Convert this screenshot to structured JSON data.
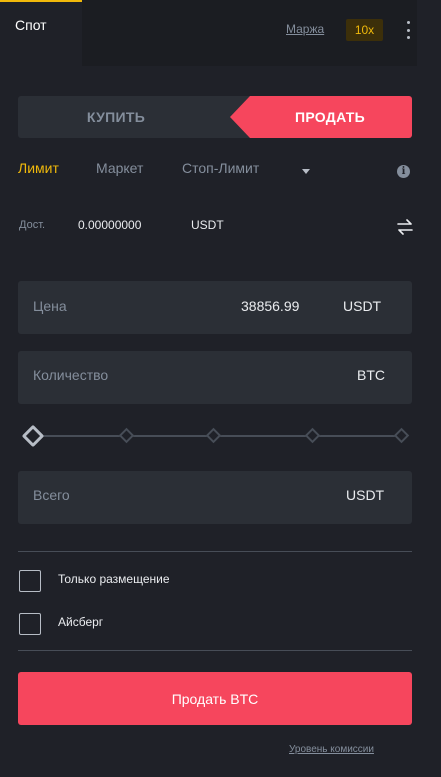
{
  "header": {
    "title": "Спот",
    "margin_label": "Маржа",
    "leverage": "10x",
    "more_icon": "kebab-menu-icon"
  },
  "side": {
    "buy_label": "КУПИТЬ",
    "sell_label": "ПРОДАТЬ",
    "active": "sell"
  },
  "order_types": {
    "limit": "Лимит",
    "market": "Маркет",
    "stop_limit": "Стоп-Лимит",
    "active": "limit"
  },
  "available": {
    "label": "Дост.",
    "value": "0.00000000",
    "unit": "USDT",
    "transfer_icon": "transfer-arrows-icon"
  },
  "price": {
    "label": "Цена",
    "value": "38856.99",
    "unit": "USDT"
  },
  "amount": {
    "label": "Количество",
    "unit": "BTC"
  },
  "slider": {
    "percent": 0,
    "steps": [
      0,
      25,
      50,
      75,
      100
    ]
  },
  "total": {
    "label": "Всего",
    "unit": "USDT"
  },
  "options": {
    "post_only_label": "Только размещение",
    "post_only_checked": false,
    "iceberg_label": "Айсберг",
    "iceberg_checked": false
  },
  "submit": {
    "label": "Продать BTC"
  },
  "fee_link": "Уровень комиссии",
  "colors": {
    "background": "#1f2128",
    "panel": "#2b2f36",
    "sell_red": "#f6465d",
    "accent_yellow": "#f0b90b",
    "muted": "#848e9c"
  }
}
